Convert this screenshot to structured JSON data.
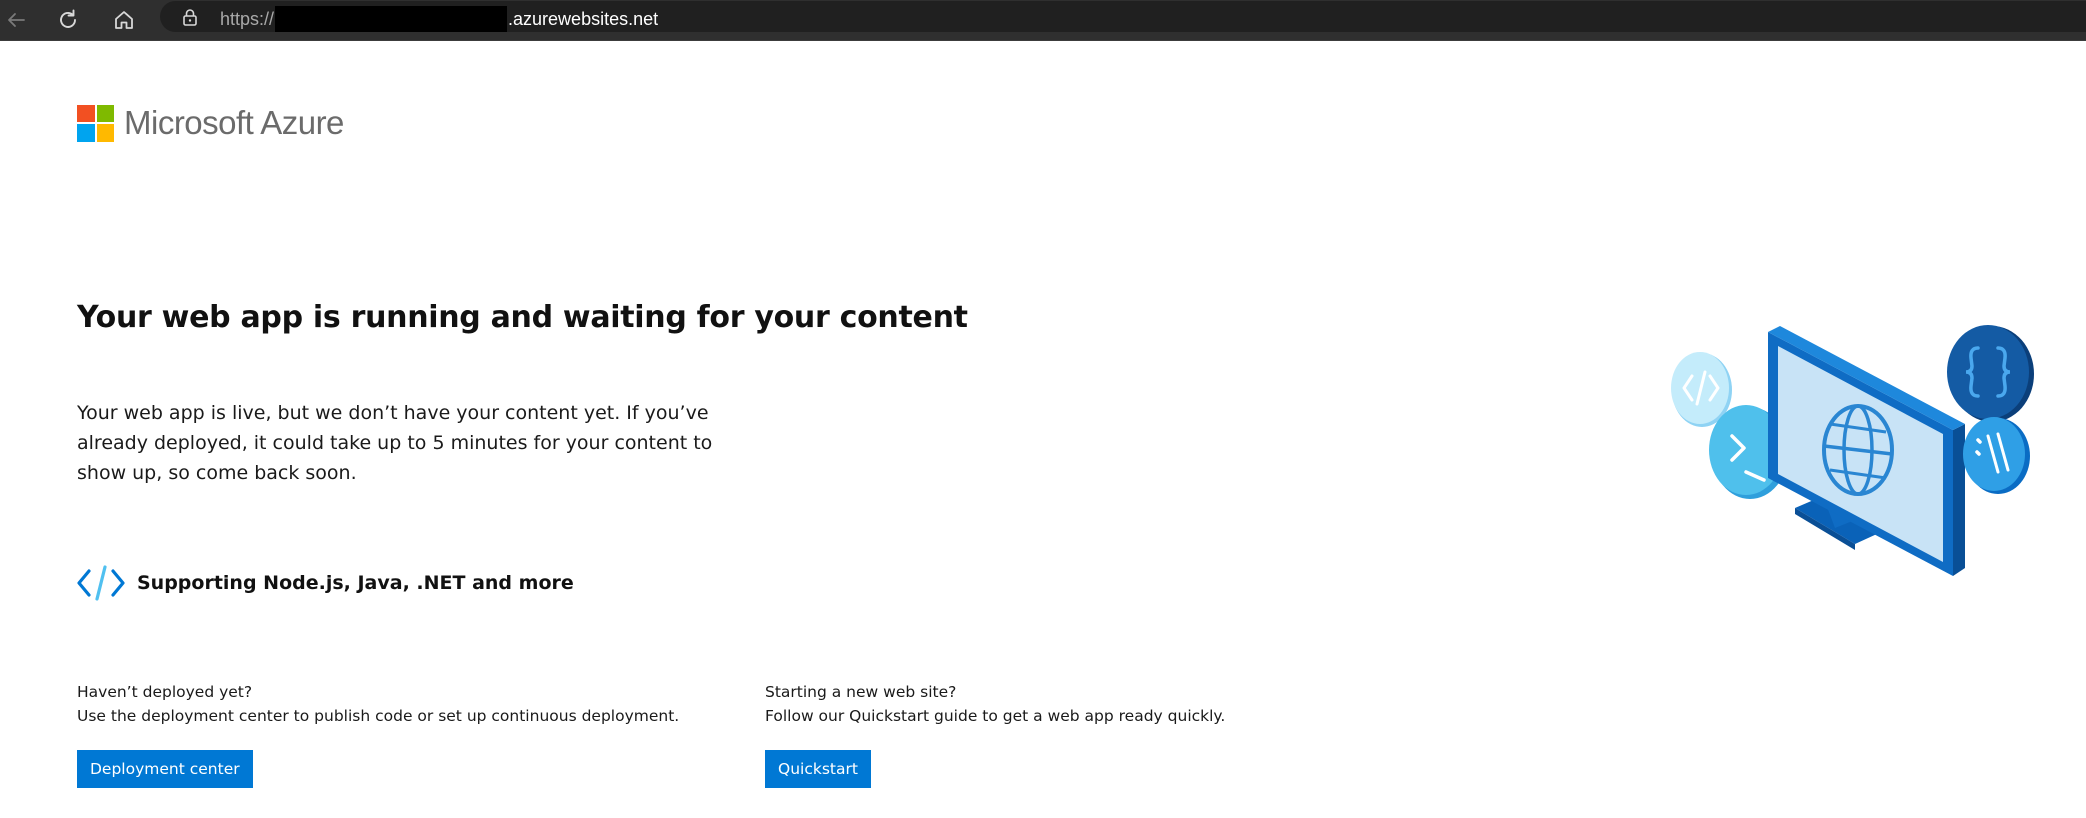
{
  "browser": {
    "url_scheme": "https://",
    "url_domain": ".azurewebsites.net"
  },
  "brand": {
    "name": "Microsoft Azure",
    "logo_colors": [
      "#f25022",
      "#7fba00",
      "#00a4ef",
      "#ffb900"
    ]
  },
  "hero": {
    "title": "Your web app is running and waiting for your content",
    "description": "Your web app is live, but we don’t have your content yet. If you’ve already deployed, it could take up to 5 minutes for your content to show up, so come back soon."
  },
  "support": {
    "icon": "code-icon",
    "text": "Supporting Node.js, Java, .NET and more"
  },
  "cta": {
    "deploy": {
      "heading": "Haven’t deployed yet?",
      "body": "Use the deployment center to publish code or set up continuous deployment.",
      "button": "Deployment center"
    },
    "quickstart": {
      "heading": "Starting a new web site?",
      "body": "Follow our Quickstart guide to get a web app ready quickly.",
      "button": "Quickstart"
    }
  },
  "theme": {
    "accent": "#0078d4"
  }
}
